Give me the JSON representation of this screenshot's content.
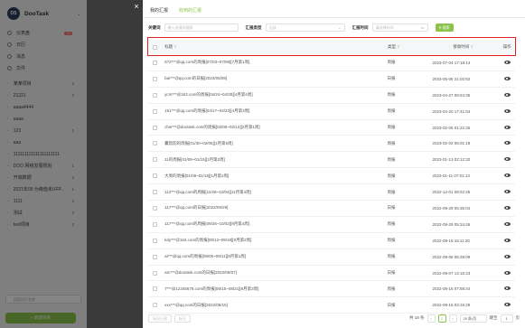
{
  "sidebar": {
    "brand": "DooTask",
    "logo_text": "DS",
    "nav": [
      {
        "label": "仪表盘",
        "badge": "13"
      },
      {
        "label": "日历",
        "badge": ""
      },
      {
        "label": "消息",
        "badge": ""
      },
      {
        "label": "文件",
        "badge": ""
      }
    ],
    "projects": [
      {
        "label": "某某项目",
        "count": "3"
      },
      {
        "label": "21221",
        "count": "2"
      },
      {
        "label": "aaaa4444",
        "count": ""
      },
      {
        "label": "aaaa",
        "count": ""
      },
      {
        "label": "123",
        "count": "1"
      },
      {
        "label": "aaa",
        "count": ""
      },
      {
        "label": "111111111111111111111",
        "count": ""
      },
      {
        "label": "DOO 网络发展规划",
        "count": "1"
      },
      {
        "label": "开端数据",
        "count": "3"
      },
      {
        "label": "2021年09 为峰值未UFP...",
        "count": "1"
      },
      {
        "label": "1111",
        "count": "2"
      },
      {
        "label": "测试",
        "count": "3"
      },
      {
        "label": "test项目",
        "count": "2"
      }
    ],
    "search_placeholder": "搜索项目名称",
    "new_project": "+ 新建项目"
  },
  "panel": {
    "tabs": [
      {
        "label": "我的汇报",
        "active": false
      },
      {
        "label": "收到的汇报",
        "active": true
      }
    ],
    "filter": {
      "keyword_label": "关键词",
      "keyword_placeholder": "输入关键词搜索",
      "type_label": "汇报类型",
      "type_placeholder": "全部",
      "time_label": "汇报时间",
      "time_placeholder": "请选择时间",
      "search_button": "搜索"
    },
    "table": {
      "headers": {
        "title": "标题",
        "type": "类型",
        "time": "接收时间",
        "op": "操作"
      },
      "rows": [
        {
          "title": "672***@qq.com的周报[07/03~07/09][7月第1周]",
          "type": "周报",
          "time": "2023-07-04 17:18:14"
        },
        {
          "title": "bai***@qq.com的日报[2023/05/08]",
          "type": "日报",
          "time": "2023-05-08 21:02:52"
        },
        {
          "title": "ycm***@163.com的周报[04/24~04/30][4月第4周]",
          "type": "周报",
          "time": "2023-04-27 09:04:35"
        },
        {
          "title": "151***@qq.com的周报[04/17~04/23][4月第3周]",
          "type": "周报",
          "time": "2023-04-20 17:41:04"
        },
        {
          "title": "chw***@dootask.com的周报[02/06~02/12][2月第1周]",
          "type": "周报",
          "time": "2023-02-06 01:22:25"
        },
        {
          "title": "囊韵韵的周报[01/30~02/05][1月第5周]",
          "type": "周报",
          "time": "2023-02-02 06:01:18"
        },
        {
          "title": "11的周报[01/09~01/15][1月第2周]",
          "type": "周报",
          "time": "2023-01-13 02:12:32"
        },
        {
          "title": "大周的周报[01/09~01/15][1月第2周]",
          "type": "周报",
          "time": "2023-01-11 07:01:13"
        },
        {
          "title": "112***@qq.com的周报[11/28~12/04][11月第4周]",
          "type": "周报",
          "time": "2022-12-01 08:02:25"
        },
        {
          "title": "117***@qq.com的日报[2022/09/29]",
          "type": "日报",
          "time": "2022-09-29 05:35:04"
        },
        {
          "title": "117***@qq.com的周报[09/26~10/02][9月第4周]",
          "type": "周报",
          "time": "2022-09-29 05:34:45"
        },
        {
          "title": "kdy***@163.com的周报[09/12~09/18][9月第2周]",
          "type": "周报",
          "time": "2022-09-16 15:11:20"
        },
        {
          "title": "ai***@qq.com的周报[09/05~09/11][9月第1周]",
          "type": "周报",
          "time": "2022-09-08 06:39:09"
        },
        {
          "title": "aIc***@dootask.com的日报[2022/09/07]",
          "type": "日报",
          "time": "2022-09-07 13:16:23"
        },
        {
          "title": "7***@12345678.com的周报[08/15~08/21][8月第3周]",
          "type": "周报",
          "time": "2022-08-16 07:58:44"
        },
        {
          "title": "xxx***@qq.com的日报[2022/08/15]",
          "type": "日报",
          "time": "2022-08-15 03:15:29"
        }
      ]
    },
    "footer": {
      "mark_read": "标记已读",
      "mark_unread": "标记",
      "total": "共 18 条",
      "current_page": "1",
      "page_size": "20 条/页",
      "jump_label": "跳至",
      "jump_value": "1",
      "page_suffix": "页"
    }
  },
  "close_icon": "×",
  "colors": {
    "accent": "#8bc34a",
    "highlight": "#e02020"
  }
}
